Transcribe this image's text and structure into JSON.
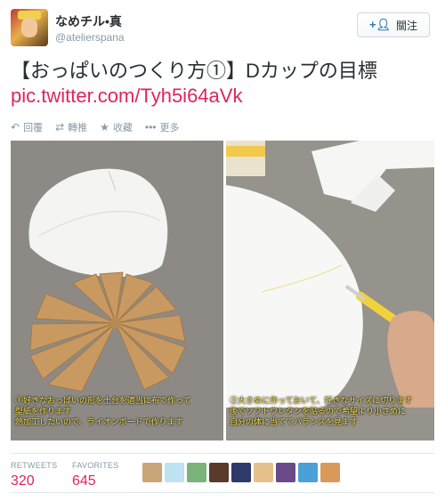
{
  "user": {
    "display_name": "なめチル•真",
    "handle": "@atelierspana"
  },
  "follow_button": {
    "icon": "add-user-icon",
    "label": "關注"
  },
  "tweet": {
    "text": "【おっぱいのつくり方①】Dカップの目標",
    "link": "pic.twitter.com/Tyh5i64aVk"
  },
  "actions": [
    {
      "icon": "reply-icon",
      "label": "回覆"
    },
    {
      "icon": "retweet-icon",
      "label": "轉推"
    },
    {
      "icon": "star-icon",
      "label": "收藏"
    },
    {
      "icon": "more-icon",
      "label": "更多"
    }
  ],
  "photos": {
    "left_caption": "①好きなおっぱいの形を土台を適当に布で作って\n型紙を作ります\n熱加工したいので、ライオンボードで作ります",
    "right_caption": "②大きめに作っておいて、好きなサイズに切ります\n後でソフトウレタンを貼るので希望より小さめに\n自分の体に当ててバランスを見ます"
  },
  "stats": {
    "retweets_label": "RETWEETS",
    "retweets": "320",
    "favorites_label": "FAVORITES",
    "favorites": "645"
  },
  "colors": {
    "link": "#e0245e",
    "muted": "#8899a6",
    "text": "#292f33",
    "caption": "#f7e24a"
  }
}
